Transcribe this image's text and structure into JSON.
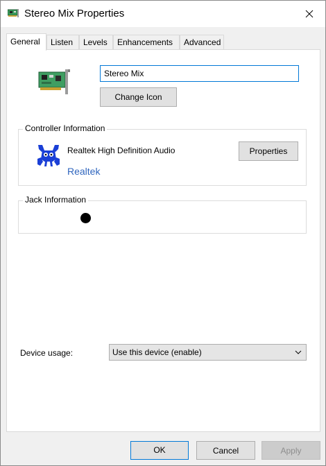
{
  "window": {
    "title": "Stereo Mix Properties",
    "close_icon": "close-icon"
  },
  "tabs": [
    {
      "label": "General",
      "active": true
    },
    {
      "label": "Listen",
      "active": false
    },
    {
      "label": "Levels",
      "active": false
    },
    {
      "label": "Enhancements",
      "active": false
    },
    {
      "label": "Advanced",
      "active": false
    }
  ],
  "general": {
    "device_name": "Stereo Mix",
    "change_icon_label": "Change Icon",
    "controller": {
      "legend": "Controller Information",
      "name": "Realtek High Definition Audio",
      "vendor": "Realtek",
      "properties_label": "Properties"
    },
    "jack": {
      "legend": "Jack Information"
    },
    "device_usage": {
      "label": "Device usage:",
      "selected": "Use this device (enable)"
    }
  },
  "buttons": {
    "ok": "OK",
    "cancel": "Cancel",
    "apply": "Apply"
  },
  "colors": {
    "accent": "#0078d7",
    "vendor_link": "#3066be"
  }
}
